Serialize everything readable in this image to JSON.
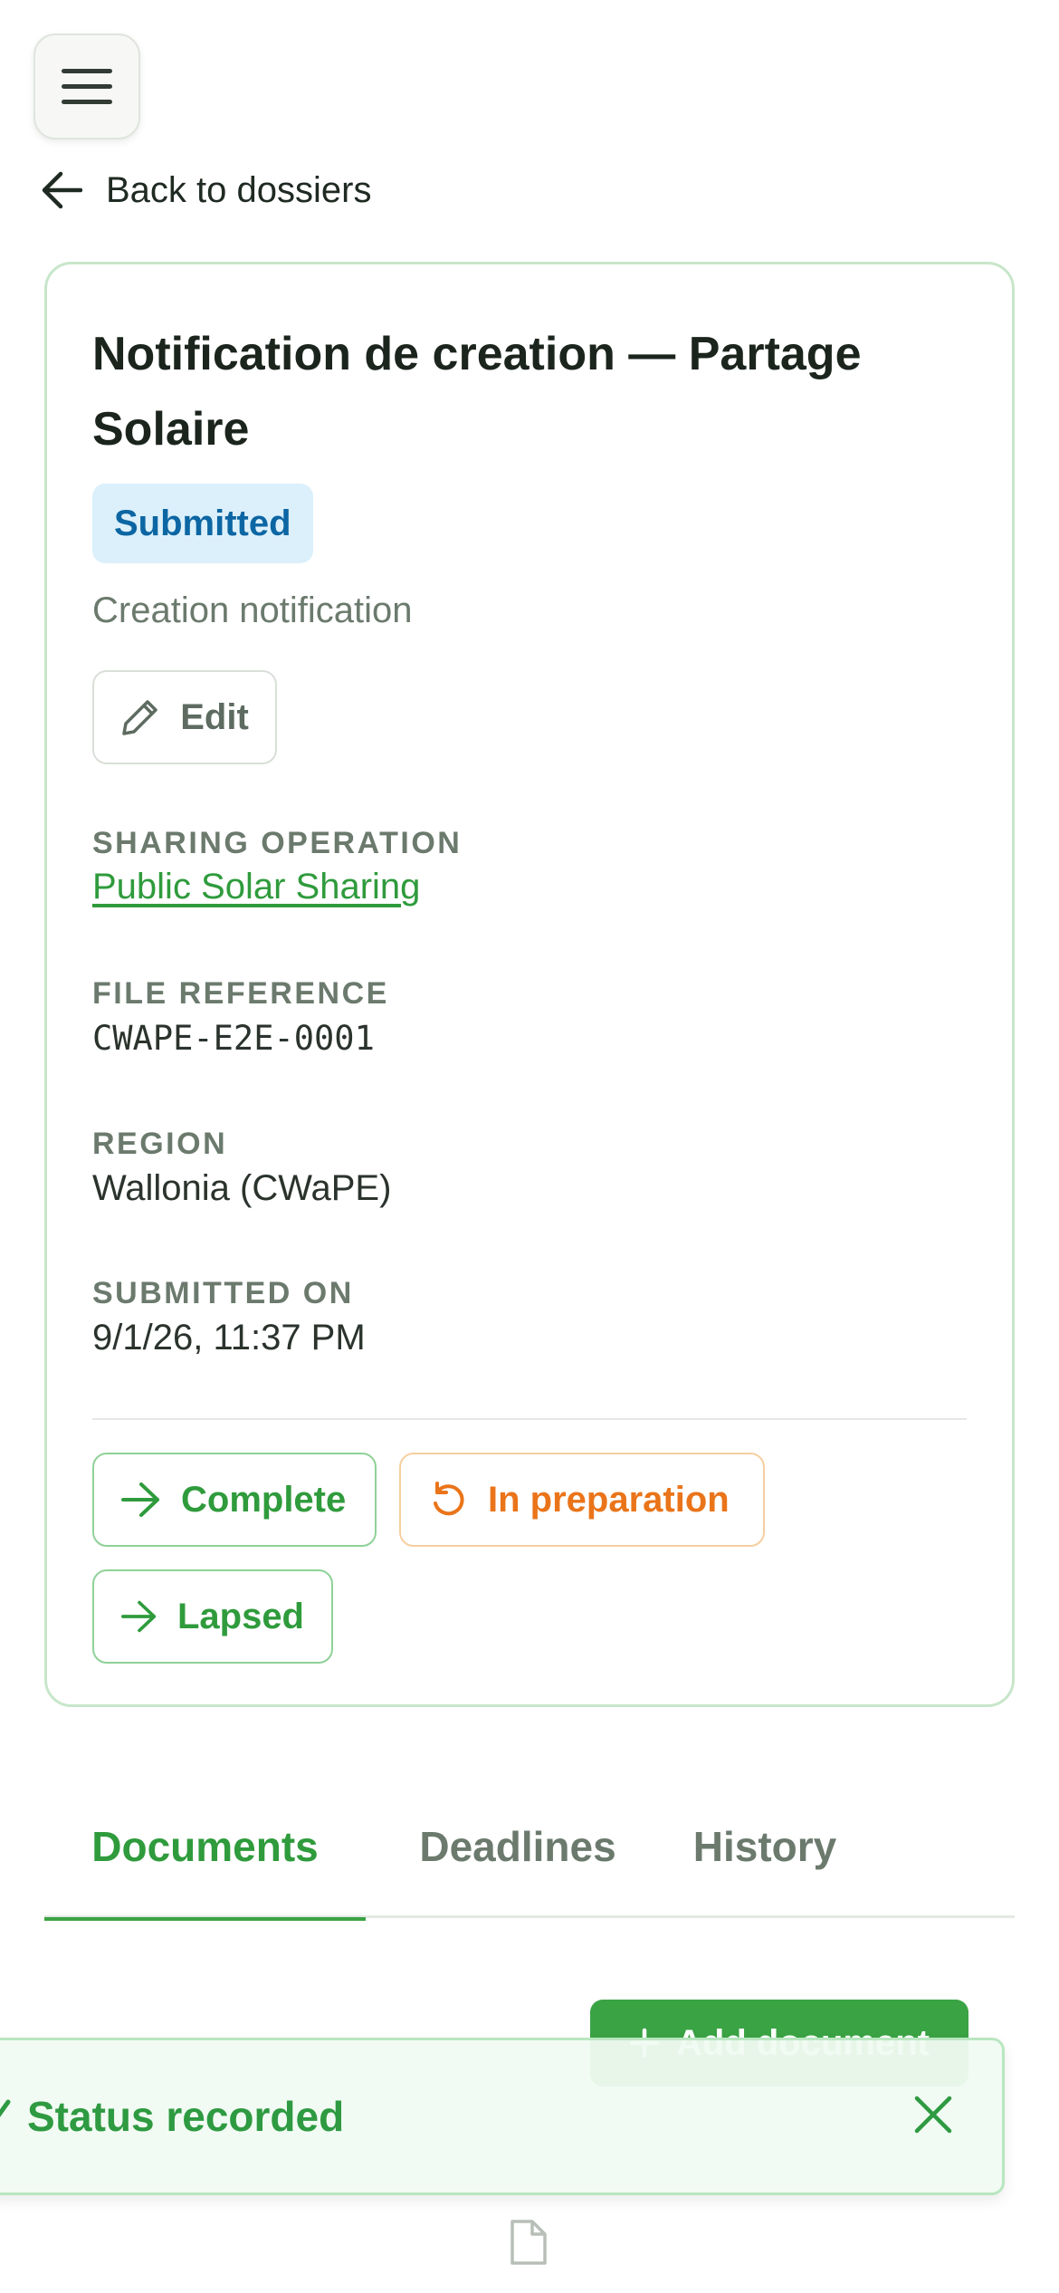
{
  "nav": {
    "back_label": "Back to dossiers"
  },
  "dossier": {
    "title": "Notification de creation — Partage Solaire",
    "status_badge": "Submitted",
    "type_label": "Creation notification",
    "edit_label": "Edit",
    "fields": {
      "sharing_operation": {
        "label": "SHARING OPERATION",
        "value": "Public Solar Sharing"
      },
      "file_reference": {
        "label": "FILE REFERENCE",
        "value": "CWAPE-E2E-0001"
      },
      "region": {
        "label": "REGION",
        "value": "Wallonia (CWaPE)"
      },
      "submitted_on": {
        "label": "SUBMITTED ON",
        "value": "9/1/26, 11:37 PM"
      }
    },
    "actions": {
      "complete": "Complete",
      "in_preparation": "In preparation",
      "lapsed": "Lapsed"
    }
  },
  "tabs": [
    {
      "label": "Documents",
      "active": true
    },
    {
      "label": "Deadlines",
      "active": false
    },
    {
      "label": "History",
      "active": false
    }
  ],
  "documents": {
    "add_label": "Add document"
  },
  "toast": {
    "message": "Status recorded"
  },
  "colors": {
    "accent": "#3aa344",
    "link": "#2f9b3c",
    "badge_bg": "#dcf0fb",
    "badge_text": "#0c66a3",
    "warning": "#ea7419"
  },
  "icons": {
    "menu": "hamburger-menu-icon",
    "back": "arrow-left-icon",
    "edit": "pencil-icon",
    "transition": "arrow-right-icon",
    "revert": "rotate-ccw-icon",
    "add": "plus-icon",
    "toast_status": "check-icon",
    "close": "close-icon",
    "empty_documents": "file-icon"
  }
}
